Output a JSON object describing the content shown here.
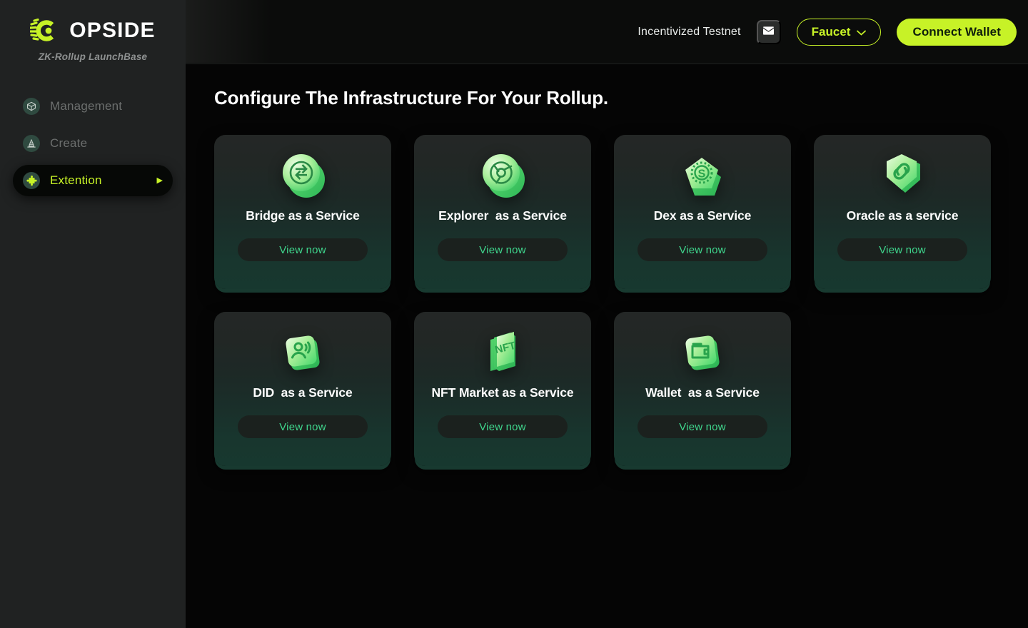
{
  "brand": {
    "logo_icon": "opside-logo-icon",
    "name": "OPSIDE",
    "tagline": "ZK-Rollup LaunchBase"
  },
  "sidebar": {
    "items": [
      {
        "label": "Management",
        "icon": "cube-icon",
        "active": false
      },
      {
        "label": "Create",
        "icon": "traffic-cone-icon",
        "active": false
      },
      {
        "label": "Extention",
        "icon": "puzzle-piece-icon",
        "active": true,
        "caret": "▶"
      }
    ]
  },
  "header": {
    "network_label": "Incentivized Testnet",
    "mail_icon": "mail-icon",
    "faucet_label": "Faucet",
    "faucet_caret_icon": "chevron-down-icon",
    "connect_label": "Connect Wallet"
  },
  "main": {
    "title": "Configure The Infrastructure For Your Rollup.",
    "cards": [
      {
        "title": "Bridge as a Service",
        "icon": "bridge-swap-coin-icon",
        "button": "View now"
      },
      {
        "title": "Explorer  as a Service",
        "icon": "explorer-globe-icon",
        "button": "View now"
      },
      {
        "title": "Dex as a Service",
        "icon": "dex-token-icon",
        "button": "View now"
      },
      {
        "title": "Oracle as a service",
        "icon": "oracle-link-shield-icon",
        "button": "View now"
      },
      {
        "title": "DID  as a Service",
        "icon": "did-person-icon",
        "button": "View now"
      },
      {
        "title": "NFT Market as a Service",
        "icon": "nft-book-icon",
        "button": "View now"
      },
      {
        "title": "Wallet  as a Service",
        "icon": "wallet-icon",
        "button": "View now"
      }
    ]
  },
  "colors": {
    "accent_lime": "#c7f227",
    "accent_green": "#3fd68d",
    "sidebar_bg": "#202222",
    "page_bg": "#050505",
    "card_top": "#242726",
    "card_bottom": "#17382f"
  }
}
